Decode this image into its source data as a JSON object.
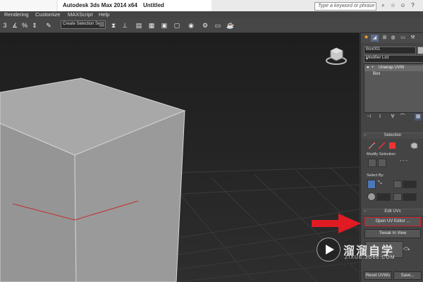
{
  "titlebar": {
    "app_title": "Autodesk 3ds Max  2014 x64",
    "document": "Untitled",
    "search_placeholder": "Type a keyword or phrase"
  },
  "menu": {
    "items": [
      "Rendering",
      "Customize",
      "MAXScript",
      "Help"
    ]
  },
  "toolbar": {
    "selection_set_placeholder": "Create Selection Se"
  },
  "command_panel": {
    "object_name": "Box001",
    "modifier_list": "Modifier List",
    "stack": [
      {
        "label": "Unwrap UVW",
        "selected": true
      },
      {
        "label": "Box",
        "selected": false
      }
    ],
    "selection_rollout": {
      "title": "Selection",
      "modify_selection_label": "Modify Selection:",
      "select_by_label": "Select By:"
    },
    "edit_uvs_rollout": {
      "title": "Edit UVs",
      "open_uv_editor": "Open UV Editor ...",
      "tweak_in_view": "Tweak In View"
    },
    "bottom_buttons": [
      "Reset UVWs",
      "Save..."
    ]
  },
  "watermark": {
    "brand": "溜溜自学",
    "url": "ZIXUE.3D66.COM"
  },
  "colors": {
    "highlight_red": "#d61f26",
    "viewport_bg": "#222222",
    "panel_bg": "#444444"
  }
}
